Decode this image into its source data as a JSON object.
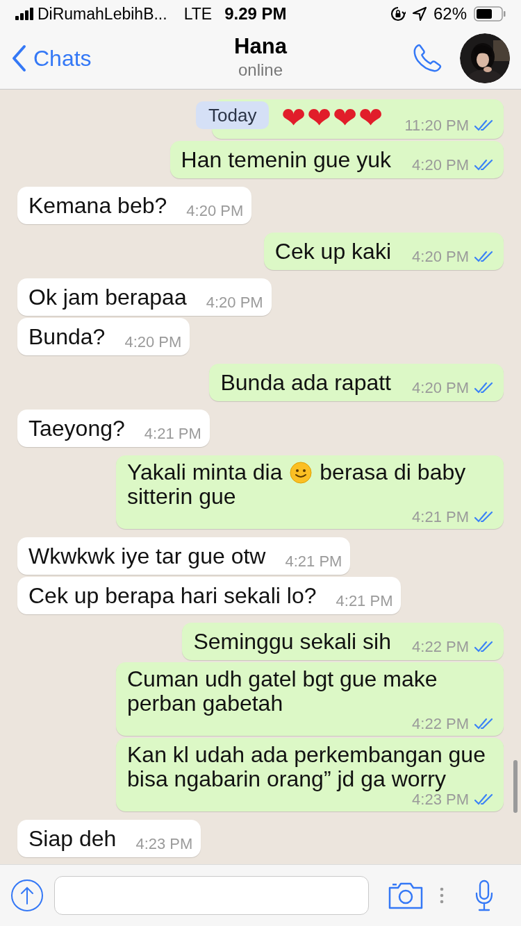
{
  "status_bar": {
    "carrier": "DiRumahLebihB...",
    "network": "LTE",
    "time": "9.29 PM",
    "battery": "62%"
  },
  "header": {
    "back": "Chats",
    "name": "Hana",
    "status": "online"
  },
  "date_badge": "Today",
  "messages": [
    {
      "outgoing": true,
      "parts": [
        {
          "kind": "hearts",
          "text": "❤❤❤❤"
        }
      ],
      "time": "11:20 PM",
      "read": true
    },
    {
      "outgoing": true,
      "parts": [
        {
          "kind": "text",
          "text": "Han temenin gue yuk"
        }
      ],
      "time": "4:20 PM",
      "read": true
    },
    {
      "outgoing": false,
      "parts": [
        {
          "kind": "text",
          "text": "Kemana beb?"
        }
      ],
      "time": "4:20 PM"
    },
    {
      "outgoing": true,
      "parts": [
        {
          "kind": "text",
          "text": "Cek up kaki"
        }
      ],
      "time": "4:20 PM",
      "read": true
    },
    {
      "outgoing": false,
      "parts": [
        {
          "kind": "text",
          "text": "Ok jam berapaa"
        }
      ],
      "time": "4:20 PM"
    },
    {
      "outgoing": false,
      "parts": [
        {
          "kind": "text",
          "text": "Bunda?"
        }
      ],
      "time": "4:20 PM"
    },
    {
      "outgoing": true,
      "parts": [
        {
          "kind": "text",
          "text": "Bunda ada rapatt"
        }
      ],
      "time": "4:20 PM",
      "read": true
    },
    {
      "outgoing": false,
      "parts": [
        {
          "kind": "text",
          "text": "Taeyong?"
        }
      ],
      "time": "4:21 PM"
    },
    {
      "outgoing": true,
      "parts": [
        {
          "kind": "text",
          "text": "Yakali minta dia "
        },
        {
          "kind": "emoji"
        },
        {
          "kind": "text",
          "text": " berasa di baby sitterin gue"
        }
      ],
      "time": "4:21 PM",
      "read": true
    },
    {
      "outgoing": false,
      "parts": [
        {
          "kind": "text",
          "text": "Wkwkwk iye tar gue otw"
        }
      ],
      "time": "4:21 PM"
    },
    {
      "outgoing": false,
      "parts": [
        {
          "kind": "text",
          "text": "Cek up berapa hari sekali lo?"
        }
      ],
      "time": "4:21 PM"
    },
    {
      "outgoing": true,
      "parts": [
        {
          "kind": "text",
          "text": "Seminggu sekali sih"
        }
      ],
      "time": "4:22 PM",
      "read": true
    },
    {
      "outgoing": true,
      "parts": [
        {
          "kind": "text",
          "text": "Cuman udh gatel bgt gue make perban gabetah"
        }
      ],
      "time": "4:22 PM",
      "read": true
    },
    {
      "outgoing": true,
      "parts": [
        {
          "kind": "text",
          "text": "Kan kl udah ada perkembangan gue bisa ngabarin orang” jd ga worry"
        }
      ],
      "time": "4:23 PM",
      "read": true
    },
    {
      "outgoing": false,
      "parts": [
        {
          "kind": "text",
          "text": "Siap deh"
        }
      ],
      "time": "4:23 PM"
    }
  ]
}
